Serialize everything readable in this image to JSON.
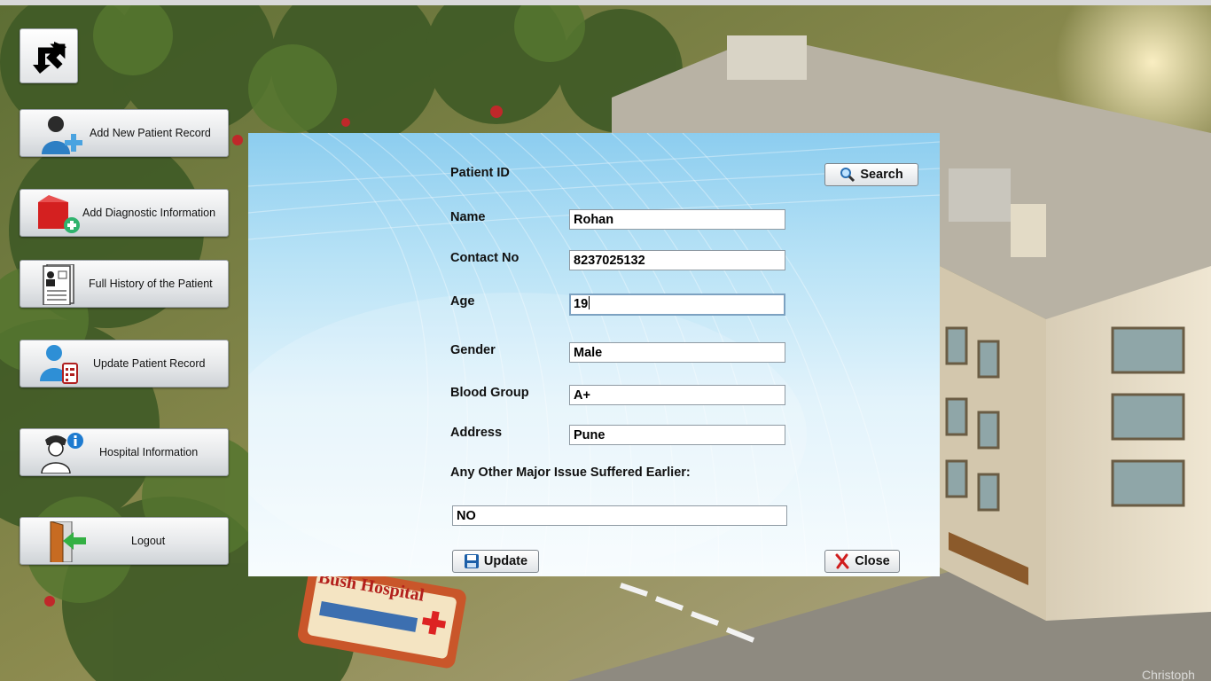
{
  "sidebar": {
    "items": [
      {
        "label": "Add New Patient Record",
        "icon": "add-user-icon"
      },
      {
        "label": "Add Diagnostic Information",
        "icon": "diagnostic-add-icon"
      },
      {
        "label": "Full History of the Patient",
        "icon": "patient-history-icon"
      },
      {
        "label": "Update Patient Record",
        "icon": "update-record-icon"
      },
      {
        "label": "Hospital Information",
        "icon": "nurse-info-icon"
      },
      {
        "label": "Logout",
        "icon": "logout-door-icon"
      }
    ],
    "top_icon": "redirect-arrows-icon"
  },
  "form": {
    "patient_id_label": "Patient ID",
    "search_label": "Search",
    "name_label": "Name",
    "name_value": "Rohan",
    "contact_label": "Contact No",
    "contact_value": "8237025132",
    "age_label": "Age",
    "age_value": "19",
    "gender_label": "Gender",
    "gender_value": "Male",
    "blood_label": "Blood Group",
    "blood_value": "A+",
    "address_label": "Address",
    "address_value": "Pune",
    "issue_label": "Any Other Major Issue Suffered Earlier:",
    "issue_value": "NO",
    "update_label": "Update",
    "close_label": "Close"
  },
  "background": {
    "sign_title": "Bush Hospital",
    "watermark": "Christoph"
  },
  "colors": {
    "dialog_top": "#8ccdef",
    "dialog_bottom": "#f7fcfe",
    "field_border": "#8f9aa3",
    "close_icon": "#d01d1d",
    "save_icon": "#1c5fa8"
  }
}
